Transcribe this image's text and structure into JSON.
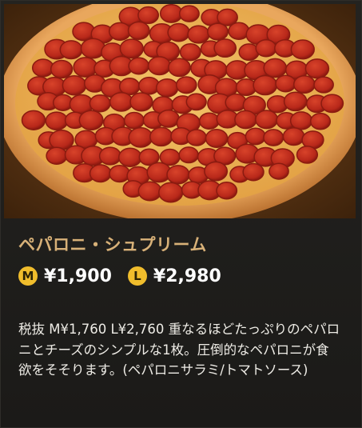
{
  "product": {
    "name": "ペパロニ・シュプリーム",
    "image_alt": "pepperoni-pizza-photo",
    "prices": [
      {
        "size": "M",
        "price": "¥1,900"
      },
      {
        "size": "L",
        "price": "¥2,980"
      }
    ],
    "description": "税抜 M¥1,760 L¥2,760 重なるほどたっぷりのペパロニとチーズのシンプルな1枚。圧倒的なペパロニが食欲をそそります。(ペパロニサラミ/トマトソース)"
  },
  "colors": {
    "title": "#d8b178",
    "badge": "#f0bd2c",
    "background": "#1d1c1a"
  }
}
